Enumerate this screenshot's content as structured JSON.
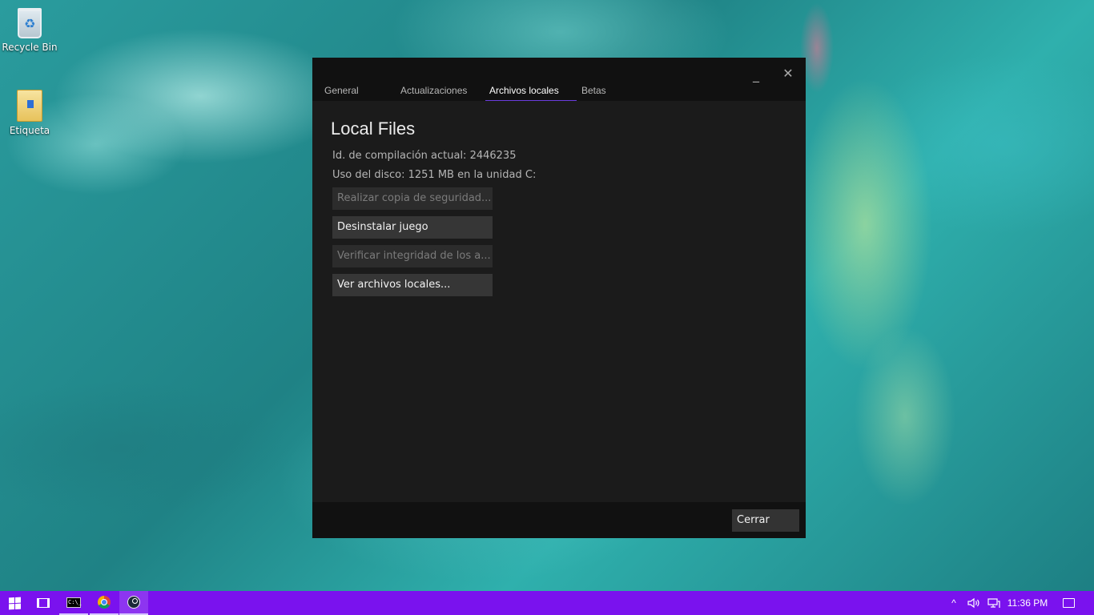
{
  "desktop": {
    "icons": [
      {
        "label": "Recycle Bin",
        "icon": "recycle-bin-icon"
      },
      {
        "label": "Etiqueta",
        "icon": "folder-icon"
      }
    ]
  },
  "dialog": {
    "controls": {
      "minimize": "_",
      "close": "✕"
    },
    "tabs": [
      {
        "label": "General",
        "active": false
      },
      {
        "label": "Actualizaciones",
        "active": false
      },
      {
        "label": "Archivos locales",
        "active": true
      },
      {
        "label": "Betas",
        "active": false
      }
    ],
    "title": "Local Files",
    "build_id": "Id. de compilación actual: 2446235",
    "disk_usage": "Uso del disco: 1251 MB en la unidad C:",
    "buttons": [
      {
        "label": "Realizar copia de seguridad...",
        "enabled": false
      },
      {
        "label": "Desinstalar juego",
        "enabled": true
      },
      {
        "label": "Verificar integridad de los a...",
        "enabled": false
      },
      {
        "label": "Ver archivos locales...",
        "enabled": true
      }
    ],
    "close_button": "Cerrar",
    "accent_color": "#6a3dde"
  },
  "taskbar": {
    "color": "#7a12ee",
    "apps": [
      {
        "name": "start",
        "icon": "windows-start-icon"
      },
      {
        "name": "task-view",
        "icon": "task-view-icon"
      },
      {
        "name": "command-prompt",
        "icon": "command-prompt-icon",
        "glyph_text": "C:\\_"
      },
      {
        "name": "chrome",
        "icon": "chrome-icon"
      },
      {
        "name": "steam",
        "icon": "steam-icon"
      }
    ],
    "tray": {
      "chevron": "^",
      "volume_icon": "volume-icon",
      "network_icon": "network-icon",
      "clock": "11:36 PM",
      "notification_icon": "action-center-icon"
    }
  }
}
